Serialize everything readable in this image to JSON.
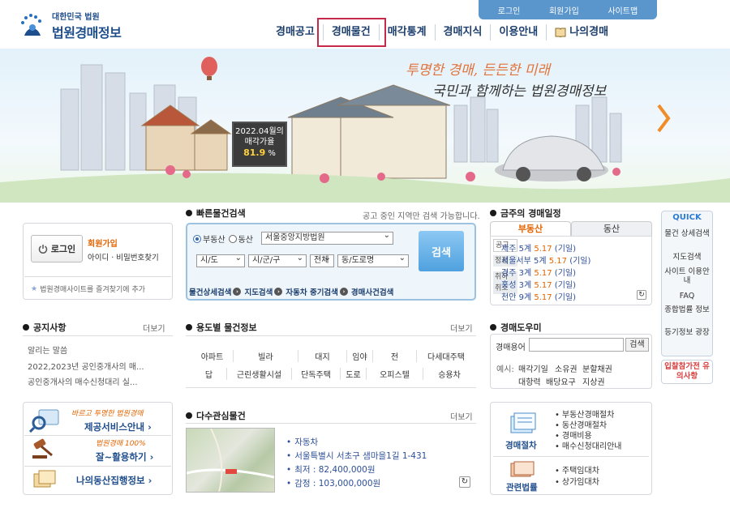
{
  "header": {
    "util": [
      "로그인",
      "회원가입",
      "사이트맵"
    ],
    "logo_sub": "대한민국 법원",
    "logo_main": "법원경매정보",
    "nav": [
      "경매공고",
      "경매물건",
      "매각통계",
      "경매지식",
      "이용안내",
      "나의경매"
    ],
    "nav_icon": "book-icon"
  },
  "hero": {
    "slogan1": "투명한 경매, 든든한 미래",
    "slogan2": "국민과 함께하는 법원경매정보",
    "billboard_line1": "2022.04월의",
    "billboard_line2": "매각가율",
    "billboard_value": "81.9",
    "billboard_unit": "%"
  },
  "login": {
    "button": "로그인",
    "join": "회원가입",
    "find": "아이디 · 비밀번호찾기",
    "favorite": "법원경매사이트를 즐겨찾기에 추가"
  },
  "quick_search": {
    "title": "빠른물건검색",
    "hint": "공고 중인 지역만 검색 가능합니다.",
    "radio_realestate": "부동산",
    "radio_movable": "동산",
    "court": "서울중앙지방법원",
    "sido": "시/도",
    "sigungu": "시/군/구",
    "dong": "전체",
    "road": "동/도로명",
    "search": "검색",
    "links": [
      "물건상세검색",
      "지도검색",
      "자동차 중기검색",
      "경매사건검색"
    ]
  },
  "schedule": {
    "title": "금주의 경매일정",
    "tab_active": "부동산",
    "tab_other": "동산",
    "side_labels": [
      "공고",
      "정정",
      "취하",
      "취소"
    ],
    "rows": [
      {
        "court": "제주 5계",
        "date": "5.17",
        "status": "(기일)"
      },
      {
        "court": "서울서부 5계",
        "date": "5.17",
        "status": "(기일)"
      },
      {
        "court": "경주 3계",
        "date": "5.17",
        "status": "(기일)"
      },
      {
        "court": "홍성 3계",
        "date": "5.17",
        "status": "(기일)"
      },
      {
        "court": "천안 9계",
        "date": "5.17",
        "status": "(기일)"
      }
    ]
  },
  "quick_menu": {
    "title": "QUICK",
    "items": [
      "물건 상세검색",
      "지도검색",
      "사이트 이용안내",
      "FAQ",
      "종합법률 정보",
      "등기정보 광장"
    ],
    "notice": "입찰참가전 유의사항"
  },
  "notice": {
    "title": "공지사항",
    "more": "더보기",
    "items": [
      "알리는 말씀",
      "2022,2023년 공인중개사의 매...",
      "공인중개사의 매수신청대리 실..."
    ]
  },
  "category": {
    "title": "용도별 물건정보",
    "more": "더보기",
    "row1": [
      "아파트",
      "빌라",
      "대지",
      "임야",
      "전",
      "다세대주택"
    ],
    "row2": [
      "답",
      "근린생활시설",
      "단독주택",
      "도로",
      "오피스텔",
      "승용차"
    ]
  },
  "glossary": {
    "title": "경매도우미",
    "label": "경매용어",
    "button": "검색",
    "example": "예시:",
    "words_row1": [
      "매각기일",
      "소유권",
      "분할채권"
    ],
    "words_row2": [
      "대항력",
      "배당요구",
      "지상권"
    ]
  },
  "banners": {
    "b1_small": "바르고 투명한 법원경매",
    "b1_main": "제공서비스안내",
    "b2_small": "법원경매 100%",
    "b2_main": "잘~활용하기",
    "b3_main": "나의동산집행정보"
  },
  "multi": {
    "title": "다수관심물건",
    "more": "더보기",
    "type": "자동차",
    "address": "서울특별시 서초구 샘마을1길 1-431",
    "min_price": "최저 : 82,400,000원",
    "appraisal": "감정 : 103,000,000원"
  },
  "procedure": {
    "label1": "경매절차",
    "items1": [
      "부동산경매절차",
      "동산경매절차",
      "경매비용",
      "매수신청대리안내"
    ],
    "label2": "관련법률",
    "items2": [
      "주택임대차",
      "상가임대차"
    ]
  },
  "colors": {
    "brand": "#1f4e8c",
    "accent_orange": "#e46400",
    "highlight_box": "#c62a4a",
    "search_button": "#4fa1df"
  }
}
